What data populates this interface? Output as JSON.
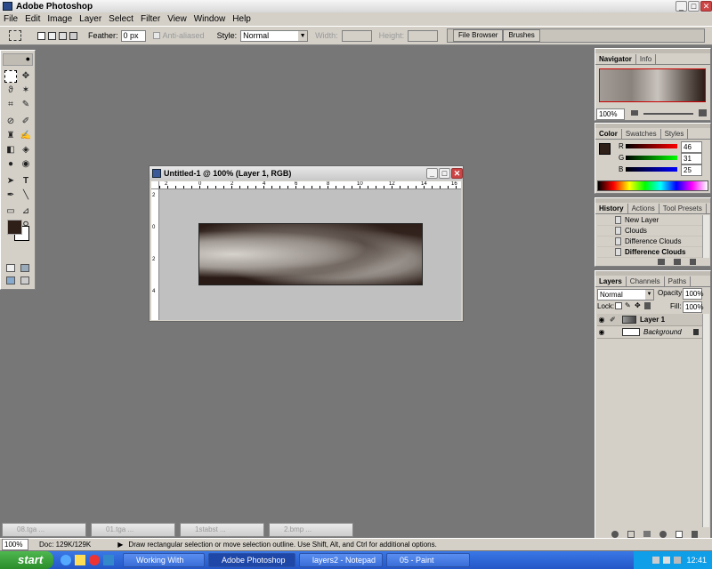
{
  "app": {
    "title": "Adobe Photoshop"
  },
  "menu": [
    "File",
    "Edit",
    "Image",
    "Layer",
    "Select",
    "Filter",
    "View",
    "Window",
    "Help"
  ],
  "options": {
    "feather_label": "Feather:",
    "feather_value": "0 px",
    "anti_aliased": "Anti-aliased",
    "style_label": "Style:",
    "style_value": "Normal",
    "width_label": "Width:",
    "height_label": "Height:",
    "well_tabs": [
      "File Browser",
      "Brushes"
    ]
  },
  "document": {
    "title": "Untitled-1 @ 100% (Layer 1, RGB)",
    "ruler_h": [
      "2",
      "0",
      "2",
      "4",
      "6",
      "8",
      "10",
      "12",
      "14",
      "16"
    ],
    "ruler_v": [
      "2",
      "0",
      "2",
      "4"
    ]
  },
  "navigator": {
    "tabs": [
      "Navigator",
      "Info"
    ],
    "zoom": "100%"
  },
  "color": {
    "tabs": [
      "Color",
      "Swatches",
      "Styles"
    ],
    "channels": [
      {
        "label": "R",
        "value": "46"
      },
      {
        "label": "G",
        "value": "31"
      },
      {
        "label": "B",
        "value": "25"
      }
    ],
    "foreground": "#2e1f19"
  },
  "history": {
    "tabs": [
      "History",
      "Actions",
      "Tool Presets"
    ],
    "items": [
      "New Layer",
      "Clouds",
      "Difference Clouds",
      "Difference Clouds"
    ]
  },
  "layers": {
    "tabs": [
      "Layers",
      "Channels",
      "Paths"
    ],
    "blend_mode": "Normal",
    "opacity_label": "Opacity:",
    "opacity_value": "100%",
    "lock_label": "Lock:",
    "fill_label": "Fill:",
    "fill_value": "100%",
    "items": [
      "Layer 1",
      "Background"
    ]
  },
  "minimized": [
    "08.tga ...",
    "01.tga ...",
    "1stabst ...",
    "2.bmp ..."
  ],
  "status": {
    "zoom": "100%",
    "doc": "Doc: 129K/129K",
    "hint": "Draw rectangular selection or move selection outline.  Use Shift, Alt, and Ctrl for additional options."
  },
  "taskbar": {
    "start": "start",
    "tasks": [
      "Working With Layers ...",
      "Adobe Photoshop",
      "layers2 - Notepad",
      "05 - Paint"
    ],
    "clock": "12:41"
  }
}
